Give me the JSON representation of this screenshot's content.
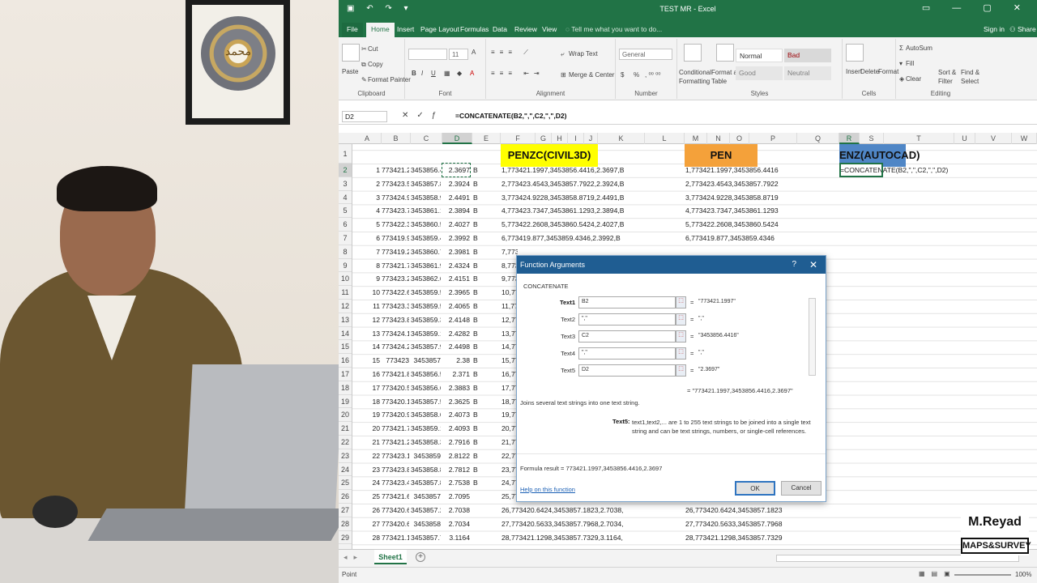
{
  "window": {
    "title": "TEST MR - Excel",
    "sign_in": "Sign in",
    "share": "Share"
  },
  "tabs": [
    "File",
    "Home",
    "Insert",
    "Page Layout",
    "Formulas",
    "Data",
    "Review",
    "View"
  ],
  "tell_me": "Tell me what you want to do...",
  "ribbon": {
    "clipboard": {
      "paste": "Paste",
      "cut": "Cut",
      "copy": "Copy",
      "format_painter": "Format Painter",
      "label": "Clipboard"
    },
    "font": {
      "size": "11",
      "label": "Font",
      "bold": "B",
      "italic": "I",
      "underline": "U"
    },
    "alignment": {
      "wrap": "Wrap Text",
      "merge": "Merge & Center",
      "label": "Alignment"
    },
    "number": {
      "format": "General",
      "label": "Number",
      "currency": "$",
      "percent": "%"
    },
    "styles": {
      "conditional": "Conditional Formatting",
      "format_as_table": "Format as Table",
      "normal": "Normal",
      "bad": "Bad",
      "good": "Good",
      "neutral": "Neutral",
      "label": "Styles"
    },
    "cells": {
      "insert": "Insert",
      "delete": "Delete",
      "format": "Format",
      "label": "Cells"
    },
    "editing": {
      "autosum": "AutoSum",
      "fill": "Fill",
      "clear": "Clear",
      "sort": "Sort & Filter",
      "find": "Find & Select",
      "label": "Editing"
    }
  },
  "formula_bar": {
    "name": "D2",
    "formula": "=CONCATENATE(B2,\",\",C2,\",\",D2)"
  },
  "columns": [
    "A",
    "B",
    "C",
    "D",
    "E",
    "F",
    "G",
    "H",
    "I",
    "J",
    "K",
    "L",
    "M",
    "N",
    "O",
    "P",
    "Q",
    "R",
    "S",
    "T",
    "U",
    "V",
    "W",
    "X"
  ],
  "headers": {
    "penzc": "PENZC(CIVIL3D)",
    "pen": "PEN",
    "enz": "ENZ(AUTOCAD)"
  },
  "rows_visible": [
    "1",
    "2",
    "3",
    "4",
    "5",
    "6",
    "7",
    "8",
    "9",
    "10",
    "11",
    "12",
    "13",
    "14",
    "15",
    "16",
    "17",
    "18",
    "19",
    "20",
    "21",
    "22",
    "23",
    "24",
    "25",
    "26",
    "27",
    "28",
    "29"
  ],
  "data_rows": [
    {
      "a": "1",
      "b": "773421.2",
      "c": "3453856.4",
      "d": "2.3697",
      "e": "B",
      "f": "1,773421.1997,3453856.4416,2.3697,B",
      "m": "1,773421.1997,3453856.4416"
    },
    {
      "a": "2",
      "b": "773423.5",
      "c": "3453857.8",
      "d": "2.3924",
      "e": "B",
      "f": "2,773423.4543,3453857.7922,2.3924,B",
      "m": "2,773423.4543,3453857.7922"
    },
    {
      "a": "3",
      "b": "773424.9",
      "c": "3453858.9",
      "d": "2.4491",
      "e": "B",
      "f": "3,773424.9228,3453858.8719,2.4491,B",
      "m": "3,773424.9228,3453858.8719"
    },
    {
      "a": "4",
      "b": "773423.7",
      "c": "3453861.1",
      "d": "2.3894",
      "e": "B",
      "f": "4,773423.7347,3453861.1293,2.3894,B",
      "m": "4,773423.7347,3453861.1293"
    },
    {
      "a": "5",
      "b": "773422.3",
      "c": "3453860.5",
      "d": "2.4027",
      "e": "B",
      "f": "5,773422.2608,3453860.5424,2.4027,B",
      "m": "5,773422.2608,3453860.5424"
    },
    {
      "a": "6",
      "b": "773419.9",
      "c": "3453859.4",
      "d": "2.3992",
      "e": "B",
      "f": "6,773419.877,3453859.4346,2.3992,B",
      "m": "6,773419.877,3453859.4346"
    },
    {
      "a": "7",
      "b": "773419.2",
      "c": "3453860.7",
      "d": "2.3981",
      "e": "B",
      "f": "7,773",
      "m": ""
    },
    {
      "a": "8",
      "b": "773421.7",
      "c": "3453861.9",
      "d": "2.4324",
      "e": "B",
      "f": "8,773",
      "m": ""
    },
    {
      "a": "9",
      "b": "773423.2",
      "c": "3453862.6",
      "d": "2.4151",
      "e": "B",
      "f": "9,773",
      "m": ""
    },
    {
      "a": "10",
      "b": "773422.6",
      "c": "3453859.5",
      "d": "2.3965",
      "e": "B",
      "f": "10,77",
      "m": ""
    },
    {
      "a": "11",
      "b": "773423.3",
      "c": "3453859.5",
      "d": "2.4065",
      "e": "B",
      "f": "11,77",
      "m": ""
    },
    {
      "a": "12",
      "b": "773423.8",
      "c": "3453859.3",
      "d": "2.4148",
      "e": "B",
      "f": "12,77",
      "m": ""
    },
    {
      "a": "13",
      "b": "773424.1",
      "c": "3453859.1",
      "d": "2.4282",
      "e": "B",
      "f": "13,77",
      "m": ""
    },
    {
      "a": "14",
      "b": "773424.2",
      "c": "3453857.9",
      "d": "2.4498",
      "e": "B",
      "f": "14,77",
      "m": ""
    },
    {
      "a": "15",
      "b": "773423",
      "c": "3453857",
      "d": "2.38",
      "e": "B",
      "f": "15,77",
      "m": ""
    },
    {
      "a": "16",
      "b": "773421.8",
      "c": "3453856.5",
      "d": "2.371",
      "e": "B",
      "f": "16,77",
      "m": ""
    },
    {
      "a": "17",
      "b": "773420.5",
      "c": "3453856.6",
      "d": "2.3883",
      "e": "B",
      "f": "17,77",
      "m": ""
    },
    {
      "a": "18",
      "b": "773420.1",
      "c": "3453857.5",
      "d": "2.3625",
      "e": "B",
      "f": "18,77",
      "m": ""
    },
    {
      "a": "19",
      "b": "773420.9",
      "c": "3453858.6",
      "d": "2.4073",
      "e": "B",
      "f": "19,77",
      "m": ""
    },
    {
      "a": "20",
      "b": "773421.7",
      "c": "3453859.1",
      "d": "2.4093",
      "e": "B",
      "f": "20,77",
      "m": ""
    },
    {
      "a": "21",
      "b": "773421.2",
      "c": "3453858.3",
      "d": "2.7916",
      "e": "B",
      "f": "21,77",
      "m": ""
    },
    {
      "a": "22",
      "b": "773423.1",
      "c": "3453859",
      "d": "2.8122",
      "e": "B",
      "f": "22,77",
      "m": ""
    },
    {
      "a": "23",
      "b": "773423.8",
      "c": "3453858.8",
      "d": "2.7812",
      "e": "B",
      "f": "23,77",
      "m": ""
    },
    {
      "a": "24",
      "b": "773423.4",
      "c": "3453857.8",
      "d": "2.7538",
      "e": "B",
      "f": "24,77",
      "m": ""
    },
    {
      "a": "25",
      "b": "773421.6",
      "c": "3453857",
      "d": "2.7095",
      "e": "",
      "f": "25,773421.5902,3453856.9704,2.7095,",
      "m": "25,773421.5902,3453856.9704"
    },
    {
      "a": "26",
      "b": "773420.6",
      "c": "3453857.2",
      "d": "2.7038",
      "e": "",
      "f": "26,773420.6424,3453857.1823,2.7038,",
      "m": "26,773420.6424,3453857.1823"
    },
    {
      "a": "27",
      "b": "773420.6",
      "c": "3453858",
      "d": "2.7034",
      "e": "",
      "f": "27,773420.5633,3453857.7968,2.7034,",
      "m": "27,773420.5633,3453857.7968"
    },
    {
      "a": "28",
      "b": "773421.1",
      "c": "3453857.7",
      "d": "3.1164",
      "e": "",
      "f": "28,773421.1298,3453857.7329,3.1164,",
      "m": "28,773421.1298,3453857.7329"
    }
  ],
  "r2_edit": "=CONCATENATE(B2,\",\",C2,\",\",D2)",
  "dialog": {
    "title": "Function Arguments",
    "help_q": "?",
    "close": "✕",
    "function": "CONCATENATE",
    "args": [
      {
        "label": "Text1",
        "value": "B2",
        "result": "\"773421.1997\"",
        "bold": true
      },
      {
        "label": "Text2",
        "value": "\",\"",
        "result": "\",\"",
        "bold": false
      },
      {
        "label": "Text3",
        "value": "C2",
        "result": "\"3453856.4416\"",
        "bold": false
      },
      {
        "label": "Text4",
        "value": "\",\"",
        "result": "\",\"",
        "bold": false
      },
      {
        "label": "Text5",
        "value": "D2",
        "result": "\"2.3697\"",
        "bold": false
      }
    ],
    "overall_result": "\"773421.1997,3453856.4416,2.3697\"",
    "description": "Joins several text strings into one text string.",
    "arg_name": "Text5:",
    "arg_help": "text1,text2,... are 1 to 255 text strings to be joined into a single text string and can be text strings, numbers, or single-cell references.",
    "formula_result_label": "Formula result =",
    "formula_result": "773421.1997,3453856.4416,2.3697",
    "help_link": "Help on this function",
    "ok": "OK",
    "cancel": "Cancel"
  },
  "sheet_tab": "Sheet1",
  "status": {
    "mode": "Point",
    "zoom": "100%"
  },
  "watermark": {
    "name": "M.Reyad",
    "subtitle": "MAPS&SURVEY"
  },
  "colors": {
    "excel_green": "#217346",
    "penzc_yellow": "#ffff00",
    "pen_orange": "#f4a13a",
    "enz_blue": "#4f86c6",
    "dialog_title": "#1f5d92"
  }
}
